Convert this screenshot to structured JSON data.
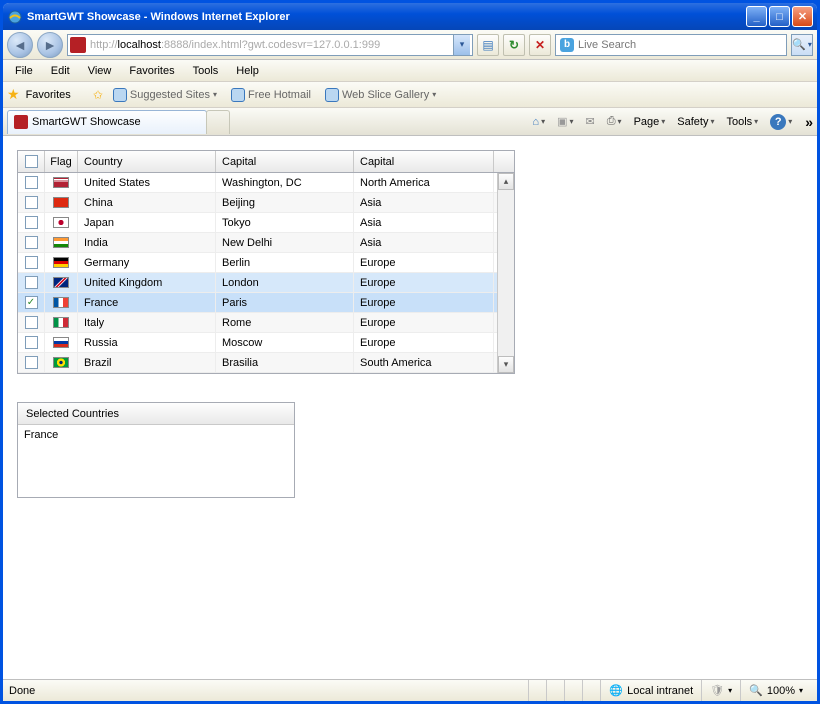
{
  "title": "SmartGWT Showcase - Windows Internet Explorer",
  "address": {
    "prefix": "http://",
    "host": "localhost",
    "suffix": ":8888/index.html?gwt.codesvr=127.0.0.1:999"
  },
  "search_placeholder": "Live Search",
  "menus": {
    "file": "File",
    "edit": "Edit",
    "view": "View",
    "favorites": "Favorites",
    "tools": "Tools",
    "help": "Help"
  },
  "favlabels": {
    "favorites": "Favorites",
    "suggested": "Suggested Sites",
    "hotmail": "Free Hotmail",
    "webslice": "Web Slice Gallery"
  },
  "tab_title": "SmartGWT Showcase",
  "cmds": {
    "page": "Page",
    "safety": "Safety",
    "tools": "Tools"
  },
  "grid": {
    "headers": {
      "flag": "Flag",
      "country": "Country",
      "cap1": "Capital",
      "cap2": "Capital"
    },
    "rows": [
      {
        "country": "United States",
        "cap1": "Washington, DC",
        "cap2": "North America",
        "flag": "us",
        "checked": false
      },
      {
        "country": "China",
        "cap1": "Beijing",
        "cap2": "Asia",
        "flag": "cn",
        "checked": false
      },
      {
        "country": "Japan",
        "cap1": "Tokyo",
        "cap2": "Asia",
        "flag": "jp",
        "checked": false
      },
      {
        "country": "India",
        "cap1": "New Delhi",
        "cap2": "Asia",
        "flag": "in",
        "checked": false
      },
      {
        "country": "Germany",
        "cap1": "Berlin",
        "cap2": "Europe",
        "flag": "de",
        "checked": false
      },
      {
        "country": "United Kingdom",
        "cap1": "London",
        "cap2": "Europe",
        "flag": "gb",
        "checked": false
      },
      {
        "country": "France",
        "cap1": "Paris",
        "cap2": "Europe",
        "flag": "fr",
        "checked": true
      },
      {
        "country": "Italy",
        "cap1": "Rome",
        "cap2": "Europe",
        "flag": "it",
        "checked": false
      },
      {
        "country": "Russia",
        "cap1": "Moscow",
        "cap2": "Europe",
        "flag": "ru",
        "checked": false
      },
      {
        "country": "Brazil",
        "cap1": "Brasilia",
        "cap2": "South America",
        "flag": "br",
        "checked": false
      }
    ]
  },
  "selected_panel": {
    "title": "Selected Countries",
    "value": "France"
  },
  "status": {
    "done": "Done",
    "zone": "Local intranet",
    "zoom": "100%"
  },
  "flags": {
    "us": "linear-gradient(#b22234 10%,#fff 10%,#fff 20%,#b22234 20%,#b22234 30%,#fff 30%,#fff 40%,#b22234 40%)",
    "cn": "#de2910",
    "jp": "radial-gradient(circle at 50% 50%, #bc002d 30%, #fff 32%)",
    "in": "linear-gradient(#ff9933 33%, #fff 33%, #fff 66%, #138808 66%)",
    "de": "linear-gradient(#000 33%, #dd0000 33%, #dd0000 66%, #ffce00 66%)",
    "gb": "linear-gradient(135deg,#00247d 40%,#fff 40%,#fff 45%,#cf142b 45%,#cf142b 55%,#fff 55%,#fff 60%,#00247d 60%)",
    "fr": "linear-gradient(90deg,#0055a4 33%,#fff 33%,#fff 66%,#ef4135 66%)",
    "it": "linear-gradient(90deg,#009246 33%,#fff 33%,#fff 66%,#ce2b37 66%)",
    "ru": "linear-gradient(#fff 33%,#0039a6 33%,#0039a6 66%,#d52b1e 66%)",
    "br": "radial-gradient(circle at 50% 50%, #002776 20%, #fedf00 22%, #fedf00 48%, #009b3a 50%)"
  }
}
